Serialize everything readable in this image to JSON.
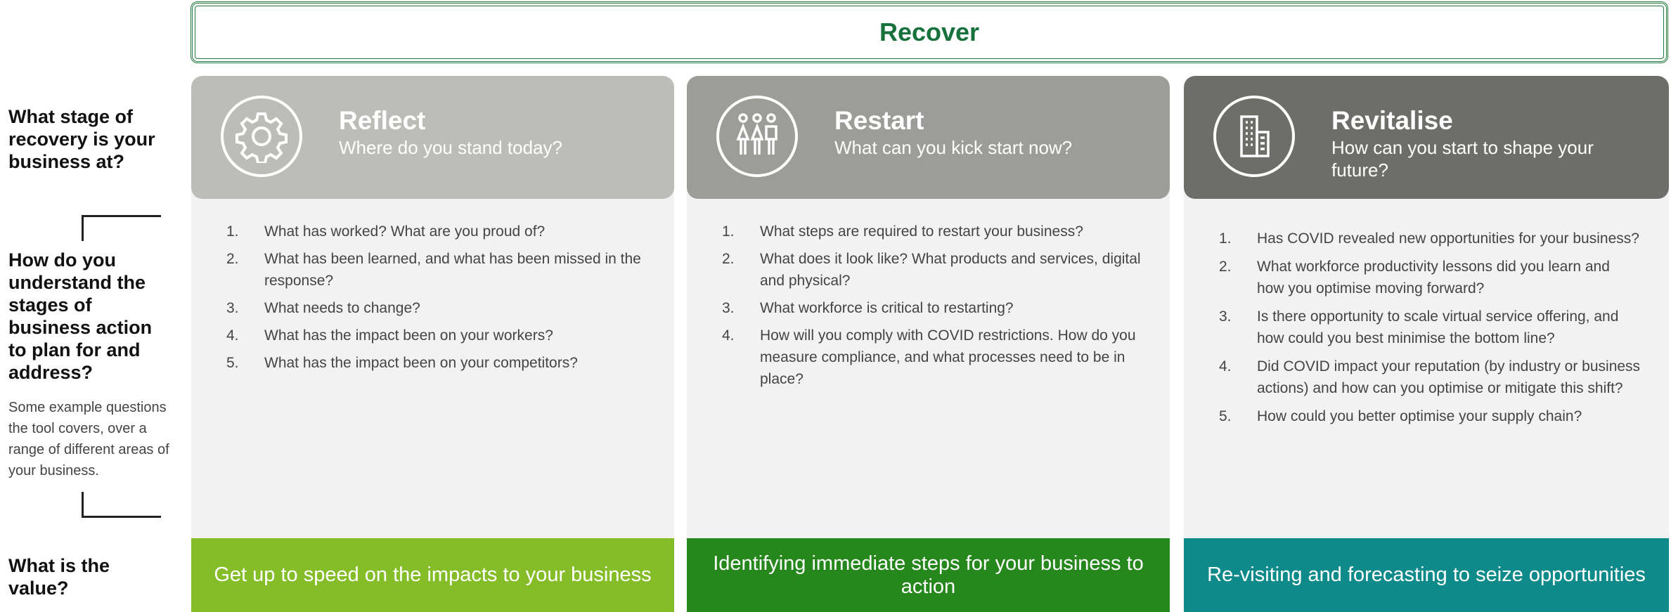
{
  "left": {
    "q_stage": "What stage of recovery is your business at?",
    "q_understand": "How do you understand the stages of business action to plan for and address?",
    "description": "Some example questions the tool covers, over a range of different areas of your business.",
    "q_value": "What is the value?"
  },
  "header": {
    "title": "Recover"
  },
  "colors": {
    "header_green": "#16713a",
    "reflect_head": "#bcbcb8",
    "restart_head": "#9c9c98",
    "revitalise_head": "#6d6d6a",
    "reflect_value": "#84bd28",
    "restart_value": "#26871d",
    "revitalise_value": "#0f8a8a"
  },
  "columns": {
    "reflect": {
      "icon": "gear-icon",
      "title": "Reflect",
      "subtitle": "Where do you stand today?",
      "questions": [
        "What has worked? What are you proud of?",
        "What has been learned, and what has been missed in the response?",
        "What needs to change?",
        "What has the impact been on your workers?",
        "What has the impact been on your competitors?"
      ],
      "value": "Get up to speed on the impacts to your business"
    },
    "restart": {
      "icon": "people-icon",
      "title": "Restart",
      "subtitle": "What can you kick start now?",
      "questions": [
        "What steps are required to restart your business?",
        "What does it look like? What products and services, digital and physical?",
        "What workforce is critical to restarting?",
        "How will you comply with COVID restrictions. How do you measure compliance, and what processes need to be in place?"
      ],
      "value": "Identifying immediate steps for your business to action"
    },
    "revitalise": {
      "icon": "buildings-icon",
      "title": "Revitalise",
      "subtitle": "How can you start to shape your future?",
      "questions": [
        "Has COVID revealed new opportunities for your business?",
        "What workforce productivity lessons did you learn and how you optimise moving forward?",
        "Is there opportunity to scale virtual service offering, and how could you best minimise the bottom line?",
        "Did COVID impact your reputation (by industry or business actions) and how can you optimise or mitigate this shift?",
        "How could you better optimise your supply chain?"
      ],
      "value": "Re-visiting and forecasting to seize opportunities"
    }
  }
}
